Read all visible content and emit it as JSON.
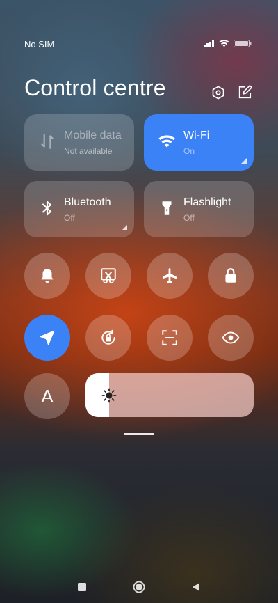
{
  "status_bar": {
    "carrier": "No SIM",
    "icons": [
      "signal-icon",
      "wifi-icon",
      "battery-icon"
    ]
  },
  "header": {
    "title": "Control centre",
    "icons": [
      "settings-icon",
      "edit-icon"
    ]
  },
  "tiles": [
    {
      "name": "Mobile data",
      "status": "Not available",
      "icon": "mobile-data-icon",
      "active": false
    },
    {
      "name": "Wi-Fi",
      "status": "On",
      "icon": "wifi-icon",
      "active": true
    },
    {
      "name": "Bluetooth",
      "status": "Off",
      "icon": "bluetooth-icon",
      "active": false
    },
    {
      "name": "Flashlight",
      "status": "Off",
      "icon": "flashlight-icon",
      "active": false
    }
  ],
  "toggles": [
    {
      "icon": "bell-icon",
      "active": false
    },
    {
      "icon": "screenshot-icon",
      "active": false
    },
    {
      "icon": "airplane-icon",
      "active": false
    },
    {
      "icon": "lock-icon",
      "active": false
    },
    {
      "icon": "location-icon",
      "active": true
    },
    {
      "icon": "rotation-lock-icon",
      "active": false
    },
    {
      "icon": "scanner-icon",
      "active": false
    },
    {
      "icon": "eye-icon",
      "active": false
    }
  ],
  "auto_brightness": {
    "label": "A"
  },
  "brightness": {
    "level": 0.14,
    "icon": "sun-icon"
  },
  "colors": {
    "active": "#3b82f6"
  },
  "nav_bar": [
    "recents-icon",
    "home-icon",
    "back-icon"
  ]
}
